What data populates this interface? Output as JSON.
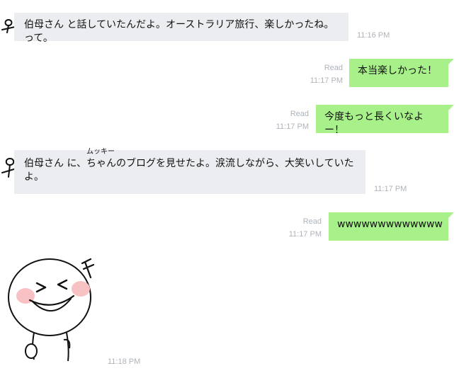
{
  "messages": [
    {
      "text": "伯母さん と話していたんだよ。オーストラリア旅行、楽しかったね。って。",
      "time": "11:16 PM"
    },
    {
      "text": "本当楽しかった！",
      "status": "Read",
      "time": "11:17 PM"
    },
    {
      "text": "今度もっと長くいなよー！",
      "status": "Read",
      "time": "11:17 PM"
    },
    {
      "text_before": "伯母さん に、",
      "ruby_base": "ちゃん",
      "ruby_text": "ムッキー",
      "text_after": "のブログを見せたよ。涙流しながら、大笑いしていたよ。",
      "time": "11:17 PM"
    },
    {
      "text": "wwwwwwwwwwwww",
      "status": "Read",
      "time": "11:17 PM"
    },
    {
      "sticker": "laughing-face-sticker",
      "time": "11:18 PM"
    }
  ],
  "colors": {
    "incoming_bubble": "#ecedf1",
    "outgoing_bubble": "#a8f08a",
    "meta_text": "#aeb3ba"
  }
}
